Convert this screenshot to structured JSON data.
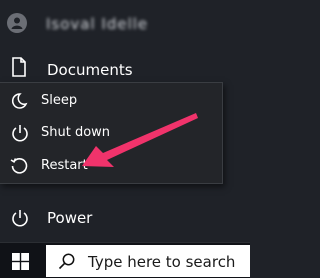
{
  "start_menu": {
    "user": {
      "name": "Isoval Idelle",
      "icon": "user-avatar-icon"
    },
    "documents": {
      "label": "Documents",
      "icon": "document-icon"
    },
    "power": {
      "label": "Power",
      "icon": "power-icon"
    }
  },
  "power_flyout": {
    "items": [
      {
        "label": "Sleep",
        "icon": "moon-icon"
      },
      {
        "label": "Shut down",
        "icon": "power-icon"
      },
      {
        "label": "Restart",
        "icon": "restart-icon"
      }
    ]
  },
  "taskbar": {
    "start_icon": "windows-logo-icon",
    "search": {
      "placeholder": "Type here to search",
      "icon": "search-icon"
    }
  },
  "annotation": {
    "color": "#f0336b",
    "points_to": "Restart"
  }
}
